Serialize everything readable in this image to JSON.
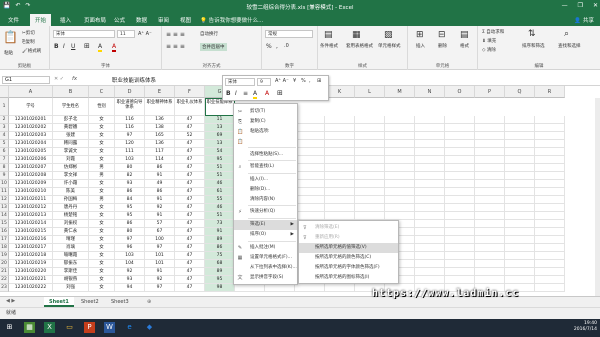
{
  "window": {
    "title": "较雪二组综合得分表.xls [兼容模式] - Excel",
    "qat_icons": [
      "save-icon",
      "undo-icon",
      "redo-icon"
    ],
    "buttons": [
      "—",
      "❐",
      "✕"
    ]
  },
  "ribbon_tabs": [
    "文件",
    "开始",
    "插入",
    "页面布局",
    "公式",
    "数据",
    "审阅",
    "视图"
  ],
  "active_tab": "开始",
  "tell_me": "告诉我你想要做什么...",
  "share": "共享",
  "ribbon": {
    "clipboard": {
      "label": "剪贴板",
      "items": [
        "剪切",
        "复制",
        "格式刷",
        "粘贴"
      ]
    },
    "font": {
      "label": "字体",
      "font_name": "宋体",
      "font_size": "11",
      "buttons": [
        "B",
        "I",
        "U",
        "A",
        "A"
      ]
    },
    "alignment": {
      "label": "对齐方式",
      "items": [
        "自动换行",
        "合并后居中"
      ]
    },
    "number": {
      "label": "数字",
      "format": "常规",
      "items": [
        "%",
        ",",
        ".0"
      ]
    },
    "styles": {
      "label": "样式",
      "items": [
        "条件格式",
        "套用表格格式",
        "单元格样式"
      ]
    },
    "cells": {
      "label": "单元格",
      "items": [
        "插入",
        "删除",
        "格式"
      ]
    },
    "editing": {
      "label": "编辑",
      "items": [
        "自动求和",
        "填充",
        "清除",
        "排序和筛选",
        "查找和选择"
      ]
    }
  },
  "formula_bar": {
    "namebox": "G1",
    "fx": "fx",
    "value": "职业技能训练体系"
  },
  "columns": [
    "A",
    "B",
    "C",
    "D",
    "E",
    "F",
    "G",
    "H",
    "I",
    "J",
    "K",
    "L",
    "M",
    "N",
    "O",
    "P",
    "Q",
    "R"
  ],
  "headers": [
    "学号",
    "学生姓名",
    "性别",
    "职业道德向导体系",
    "职业精神体系",
    "职业礼仪体系",
    "职业技能体系"
  ],
  "rows": [
    [
      "12301020201",
      "彭子北",
      "女",
      "116",
      "136",
      "47",
      "11"
    ],
    [
      "12301020202",
      "黄碧娥",
      "女",
      "116",
      "138",
      "47",
      "13"
    ],
    [
      "12301020203",
      "张建",
      "女",
      "97",
      "165",
      "52",
      "69"
    ],
    [
      "12301020204",
      "韩同露",
      "女",
      "120",
      "136",
      "47",
      "13"
    ],
    [
      "12301020205",
      "李诚文",
      "女",
      "111",
      "117",
      "47",
      "54"
    ],
    [
      "12301020206",
      "刘霞",
      "女",
      "103",
      "114",
      "47",
      "95"
    ],
    [
      "12301020207",
      "仿郑彬",
      "男",
      "80",
      "86",
      "47",
      "51"
    ],
    [
      "12301020208",
      "李文祥",
      "男",
      "82",
      "91",
      "47",
      "51"
    ],
    [
      "12301020209",
      "许小霜",
      "女",
      "93",
      "49",
      "47",
      "46"
    ],
    [
      "12301020210",
      "陈美",
      "女",
      "86",
      "86",
      "47",
      "61"
    ],
    [
      "12301020211",
      "孙国梅",
      "男",
      "84",
      "91",
      "47",
      "55"
    ],
    [
      "12301020212",
      "唐丹丹",
      "女",
      "95",
      "92",
      "47",
      "46"
    ],
    [
      "12301020213",
      "杨楚铭",
      "女",
      "95",
      "91",
      "47",
      "51"
    ],
    [
      "12301020214",
      "刘振权",
      "女",
      "86",
      "57",
      "47",
      "73"
    ],
    [
      "12301020215",
      "黄仁永",
      "女",
      "80",
      "67",
      "47",
      "91"
    ],
    [
      "12301020216",
      "晴瑾",
      "女",
      "97",
      "100",
      "47",
      "89"
    ],
    [
      "12301020217",
      "肖璃",
      "女",
      "96",
      "97",
      "47",
      "86"
    ],
    [
      "12301020218",
      "喻曙霞",
      "女",
      "103",
      "101",
      "47",
      "75"
    ],
    [
      "12301020219",
      "郁振东",
      "女",
      "104",
      "101",
      "47",
      "68"
    ],
    [
      "12301020220",
      "李斯佳",
      "女",
      "92",
      "91",
      "47",
      "89"
    ],
    [
      "12301020221",
      "胡银燕",
      "女",
      "93",
      "92",
      "47",
      "95"
    ],
    [
      "12301020222",
      "刘强",
      "女",
      "94",
      "97",
      "47",
      "98"
    ]
  ],
  "mini_toolbar": {
    "font": "宋体",
    "size": "9",
    "buttons": [
      "B",
      "I",
      "≡",
      "A",
      "A",
      "%",
      ",",
      "⊞"
    ]
  },
  "context_menu": [
    {
      "label": "剪切(T)",
      "icon": "✂"
    },
    {
      "label": "复制(C)",
      "icon": "⎘"
    },
    {
      "label": "粘贴选项:",
      "icon": "📋"
    },
    {
      "label": "",
      "icon": "📋"
    },
    {
      "label": "选择性粘贴(S)...",
      "icon": ""
    },
    {
      "label": "智能查找(L)",
      "icon": "⌕"
    },
    {
      "label": "插入(I)...",
      "icon": ""
    },
    {
      "label": "删除(D)...",
      "icon": ""
    },
    {
      "label": "清除内容(N)",
      "icon": ""
    },
    {
      "label": "快速分析(Q)",
      "icon": "⚡"
    },
    {
      "label": "筛选(E)",
      "icon": "",
      "arrow": "▶"
    },
    {
      "label": "排序(O)",
      "icon": "",
      "arrow": "▶"
    },
    {
      "label": "插入批注(M)",
      "icon": "✎"
    },
    {
      "label": "设置单元格格式(F)...",
      "icon": "▦"
    },
    {
      "label": "从下拉列表中选择(K)...",
      "icon": ""
    },
    {
      "label": "显示拼音字段(S)",
      "icon": "文"
    },
    {
      "label": "定义名称(A)...",
      "icon": ""
    },
    {
      "label": "超链接(I)...",
      "icon": "🔗"
    }
  ],
  "submenu": [
    {
      "label": "清除筛选(E)",
      "disabled": true
    },
    {
      "label": "重新应用(R)",
      "disabled": true
    },
    {
      "label": "按所选单元格的值筛选(V)",
      "disabled": false
    },
    {
      "label": "按所选单元格的颜色筛选(C)",
      "disabled": false
    },
    {
      "label": "按所选单元格的字体颜色筛选(F)",
      "disabled": false
    },
    {
      "label": "按所选单元格的图标筛选(I)",
      "disabled": false
    }
  ],
  "sheets": [
    "Sheet1",
    "Sheet2",
    "Sheet3"
  ],
  "add_sheet": "⊕",
  "status": {
    "ready": "就绪"
  },
  "taskbar": {
    "time": "19:40",
    "date": "2016/7/14"
  },
  "watermark": "https://www.ladmin.cc",
  "colors": {
    "excel_green": "#217346",
    "selection_fill": "#d3e9da"
  }
}
